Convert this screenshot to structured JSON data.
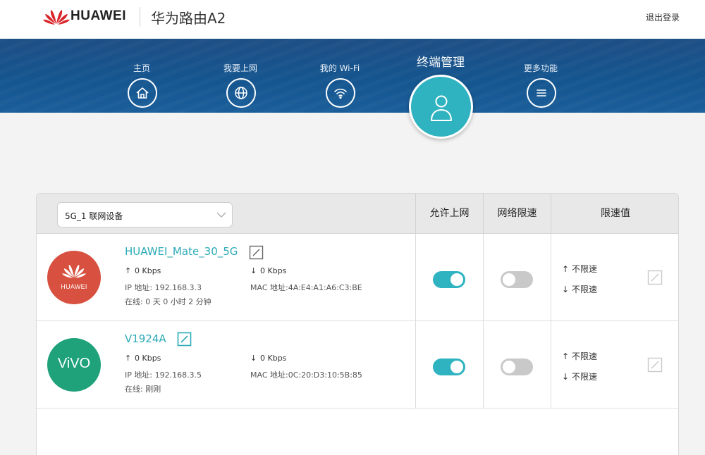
{
  "header": {
    "brand": "HUAWEI",
    "product": "华为路由A2",
    "logout": "退出登录"
  },
  "nav": {
    "items": [
      {
        "label": "主页",
        "icon": "home-icon"
      },
      {
        "label": "我要上网",
        "icon": "globe-icon"
      },
      {
        "label": "我的 Wi-Fi",
        "icon": "wifi-icon"
      },
      {
        "label": "终端管理",
        "icon": "user-icon",
        "active": true
      },
      {
        "label": "更多功能",
        "icon": "menu-icon"
      }
    ]
  },
  "table": {
    "selector_value": "5G_1 联网设备",
    "columns": [
      "允许上网",
      "网络限速",
      "限速值"
    ],
    "devices": [
      {
        "avatar_text": "HUAWEI",
        "name": "HUAWEI_Mate_30_5G",
        "upload": "0 Kbps",
        "download": "0 Kbps",
        "ip": "IP 地址: 192.168.3.3",
        "mac": "MAC 地址:4A:E4:A1:A6:C3:BE",
        "online": "在线: 0 天 0 小时 2 分钟",
        "allow_internet": true,
        "speed_limit": false,
        "limit_up": "不限速",
        "limit_down": "不限速"
      },
      {
        "avatar_text": "ViVO",
        "name": "V1924A",
        "upload": "0 Kbps",
        "download": "0 Kbps",
        "ip": "IP 地址: 192.168.3.5",
        "mac": "MAC 地址:0C:20:D3:10:5B:85",
        "online": "在线: 刚刚",
        "allow_internet": true,
        "speed_limit": false,
        "limit_up": "不限速",
        "limit_down": "不限速"
      }
    ]
  },
  "colors": {
    "accent": "#2fb3c0",
    "huawei_red": "#d8503f",
    "vivo_green": "#1fa27a",
    "nav_blue": "#1a5590"
  }
}
